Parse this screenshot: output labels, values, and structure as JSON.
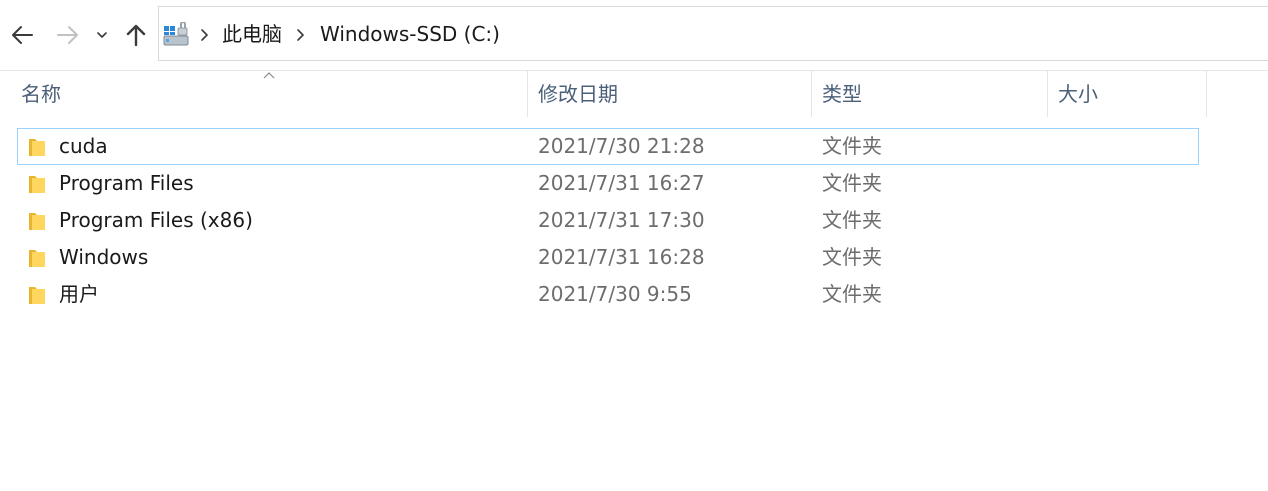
{
  "navigation": {
    "back_icon": "arrow-left-icon",
    "forward_icon": "arrow-right-icon",
    "recent_icon": "chevron-down-icon",
    "up_icon": "arrow-up-icon"
  },
  "address_bar": {
    "location_icon": "drive-icon",
    "breadcrumbs": [
      "此电脑",
      "Windows-SSD (C:)"
    ]
  },
  "columns": [
    {
      "label": "名称",
      "sorted": "ascending"
    },
    {
      "label": "修改日期"
    },
    {
      "label": "类型"
    },
    {
      "label": "大小"
    }
  ],
  "files": [
    {
      "name": "cuda",
      "modified": "2021/7/30 21:28",
      "type": "文件夹",
      "size": "",
      "icon": "folder-icon",
      "focused": true
    },
    {
      "name": "Program Files",
      "modified": "2021/7/31 16:27",
      "type": "文件夹",
      "size": "",
      "icon": "folder-icon"
    },
    {
      "name": "Program Files (x86)",
      "modified": "2021/7/31 17:30",
      "type": "文件夹",
      "size": "",
      "icon": "folder-icon"
    },
    {
      "name": "Windows",
      "modified": "2021/7/31 16:28",
      "type": "文件夹",
      "size": "",
      "icon": "folder-icon"
    },
    {
      "name": "用户",
      "modified": "2021/7/30 9:55",
      "type": "文件夹",
      "size": "",
      "icon": "folder-icon"
    }
  ],
  "colors": {
    "folder": "#ffd75e",
    "folder_dark": "#e8b530",
    "header_text": "#4c607a",
    "focus_border": "#99d1ff"
  }
}
